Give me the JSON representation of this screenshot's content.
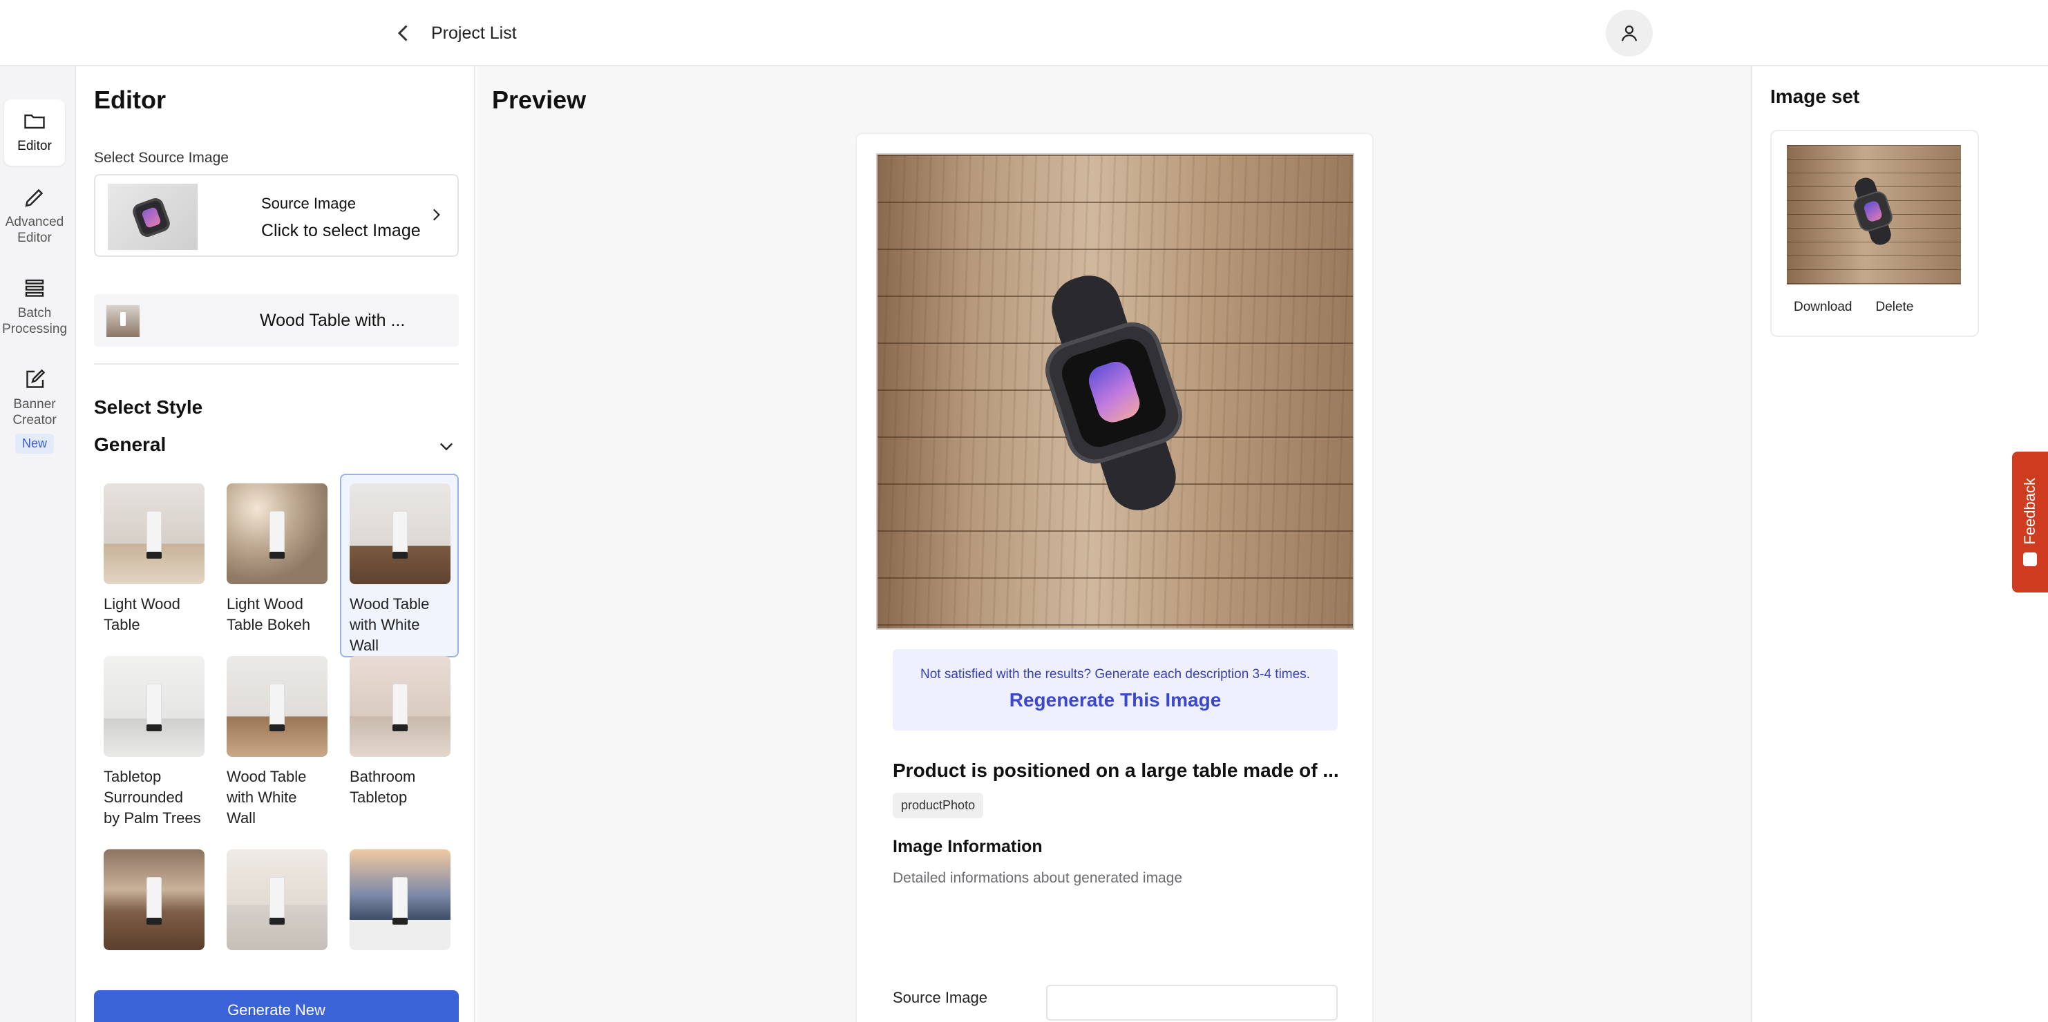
{
  "header": {
    "back_label": "Project List"
  },
  "rail": {
    "items": [
      {
        "label": "Editor",
        "icon": "folder-icon"
      },
      {
        "label": "Advanced Editor",
        "icon": "pencil-icon"
      },
      {
        "label": "Batch Processing",
        "icon": "stack-icon"
      },
      {
        "label": "Banner Creator",
        "icon": "edit-square-icon",
        "badge": "New"
      }
    ]
  },
  "editor": {
    "title": "Editor",
    "source_label": "Select Source Image",
    "source_title": "Source Image",
    "source_cta": "Click to select Image",
    "selected_style": "Wood Table with ...",
    "select_style_heading": "Select Style",
    "group_heading": "General",
    "styles": [
      {
        "label": "Light Wood Table"
      },
      {
        "label": "Light Wood Table Bokeh"
      },
      {
        "label": "Wood Table with White Wall"
      },
      {
        "label": "Tabletop Surrounded by Palm Trees"
      },
      {
        "label": "Wood Table with White Wall"
      },
      {
        "label": "Bathroom Tabletop"
      },
      {
        "label": ""
      },
      {
        "label": ""
      },
      {
        "label": ""
      }
    ],
    "generate_label": "Generate New"
  },
  "preview": {
    "title": "Preview",
    "regen_hint": "Not satisfied with the results? Generate each description 3-4 times.",
    "regen_label": "Regenerate This Image",
    "product_title": "Product is positioned on a large table made of ...",
    "tag": "productPhoto",
    "info_heading": "Image Information",
    "info_desc": "Detailed informations about generated image",
    "source_field_label": "Source Image"
  },
  "image_set": {
    "title": "Image set",
    "download_label": "Download",
    "delete_label": "Delete"
  },
  "feedback_label": "Feedback",
  "colors": {
    "primary": "#3b63d8",
    "accent_link": "#3b47cc",
    "feedback": "#cf3b1f"
  }
}
